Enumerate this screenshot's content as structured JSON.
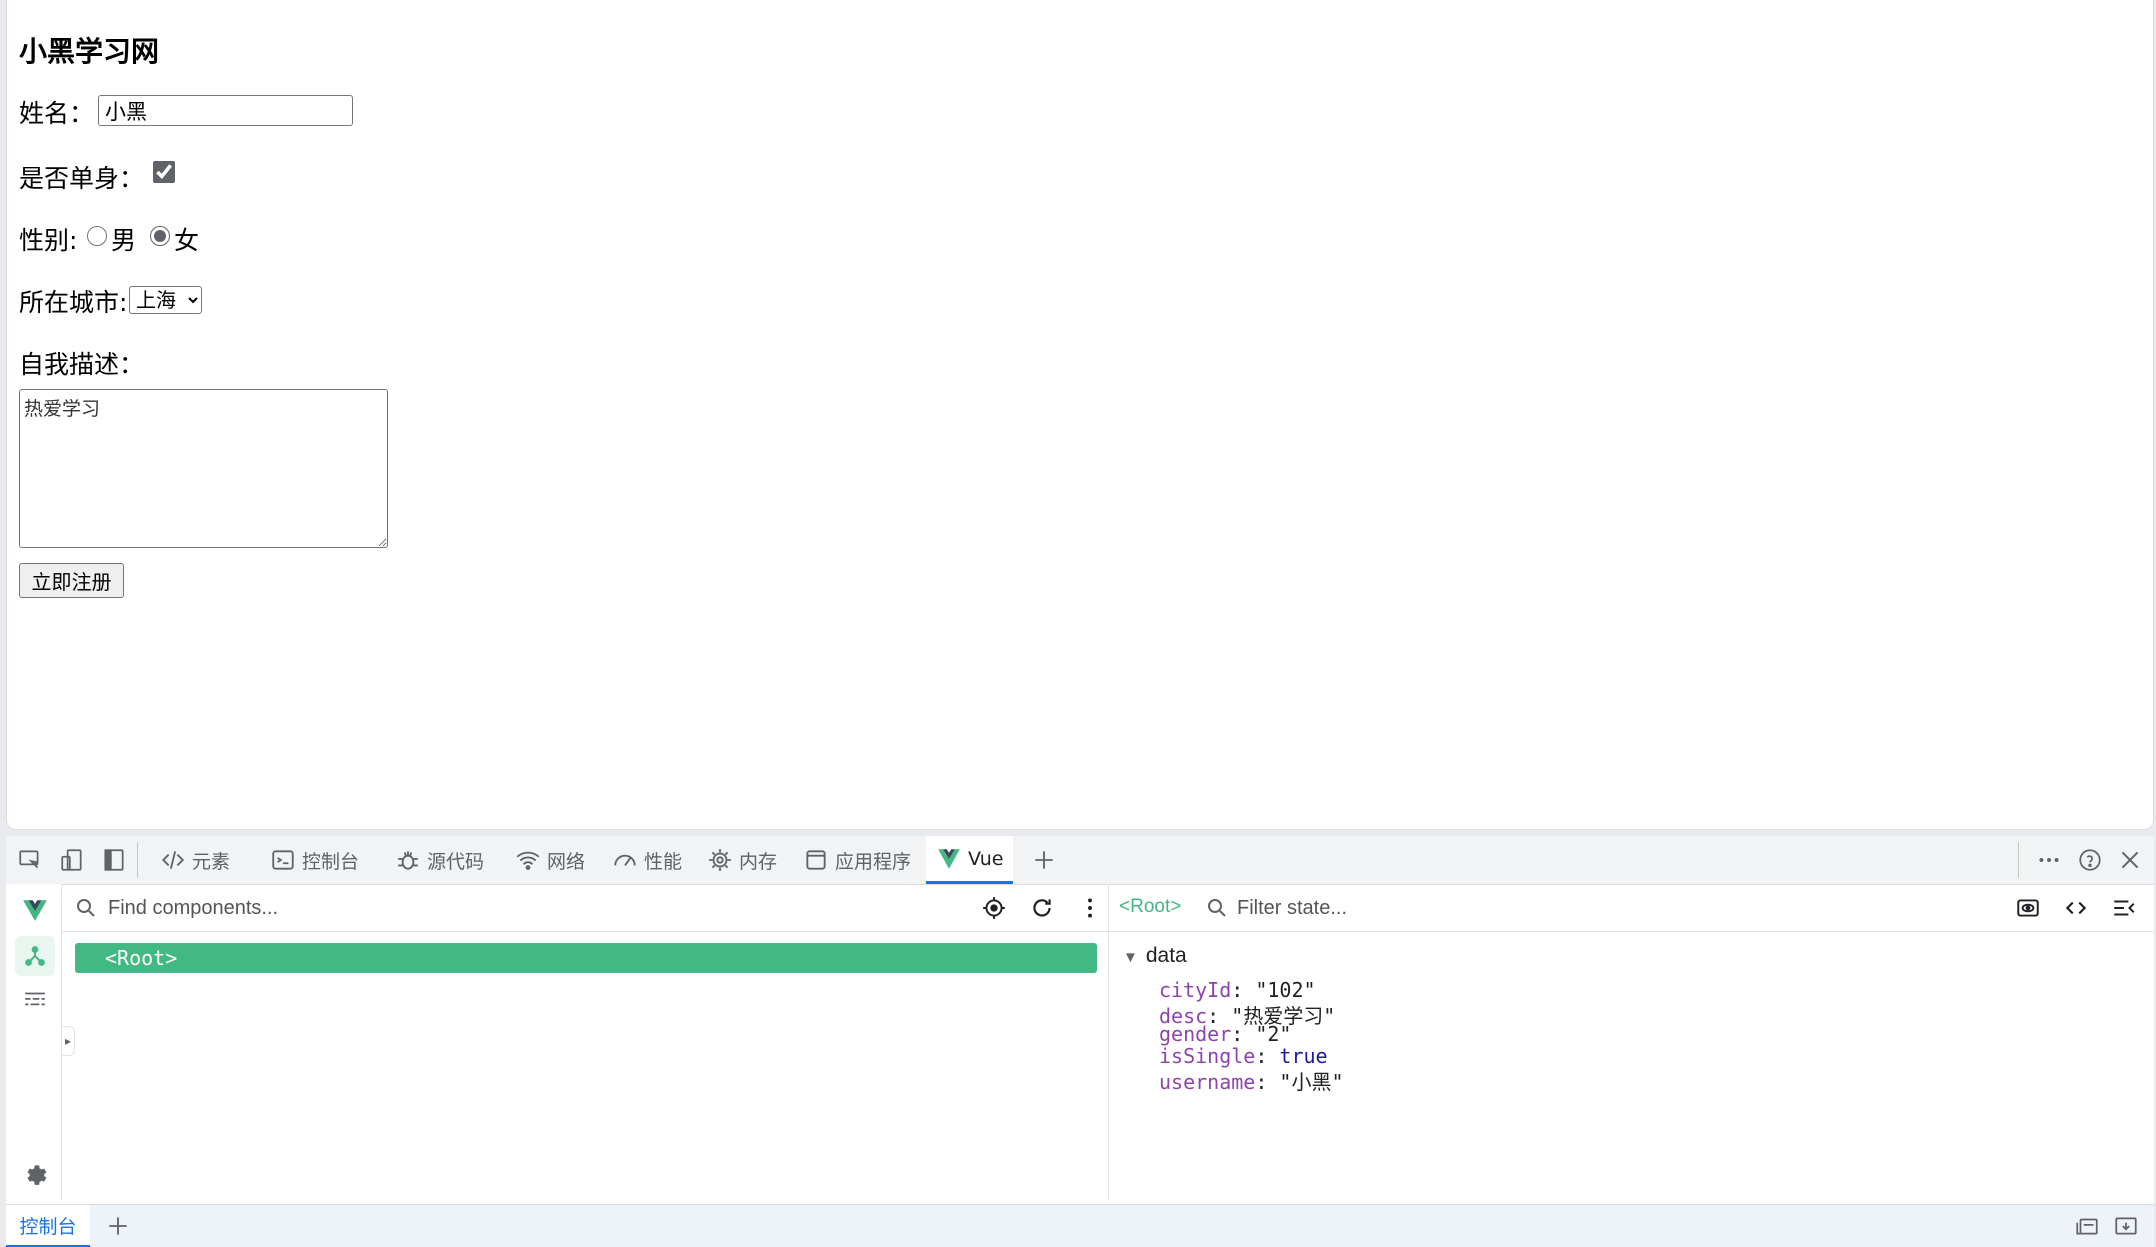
{
  "page": {
    "heading": "小黑学习网",
    "name_label": "姓名：",
    "name_value": "小黑",
    "single_label": "是否单身：",
    "single_checked": true,
    "gender_label": "性别:",
    "gender_options": [
      "男",
      "女"
    ],
    "gender_selected": "女",
    "city_label": "所在城市:",
    "city_selected": "上海",
    "desc_label": "自我描述：",
    "desc_value": "热爱学习",
    "register_button": "立即注册"
  },
  "devtools": {
    "tabs": [
      {
        "label": "元素",
        "icon": "code-icon"
      },
      {
        "label": "控制台",
        "icon": "console-icon"
      },
      {
        "label": "源代码",
        "icon": "bug-icon"
      },
      {
        "label": "网络",
        "icon": "wifi-icon"
      },
      {
        "label": "性能",
        "icon": "gauge-icon"
      },
      {
        "label": "内存",
        "icon": "chip-icon"
      },
      {
        "label": "应用程序",
        "icon": "window-icon"
      },
      {
        "label": "Vue",
        "icon": "vue-logo-icon",
        "active": true
      }
    ],
    "find_placeholder": "Find components...",
    "root_component": "<Root>",
    "root_crumb": "<Root>",
    "filter_placeholder": "Filter state...",
    "data_section": "data",
    "state": [
      {
        "key": "cityId",
        "value": "\"102\"",
        "type": "string"
      },
      {
        "key": "desc",
        "value": "\"热爱学习\"",
        "type": "string"
      },
      {
        "key": "gender",
        "value": "\"2\"",
        "type": "string"
      },
      {
        "key": "isSingle",
        "value": "true",
        "type": "boolean"
      },
      {
        "key": "username",
        "value": "\"小黑\"",
        "type": "string"
      }
    ],
    "drawer_tab": "控制台"
  },
  "colors": {
    "vue_green": "#42b883",
    "accent_blue": "#1a73e8",
    "prop_key": "#8e44ad"
  }
}
